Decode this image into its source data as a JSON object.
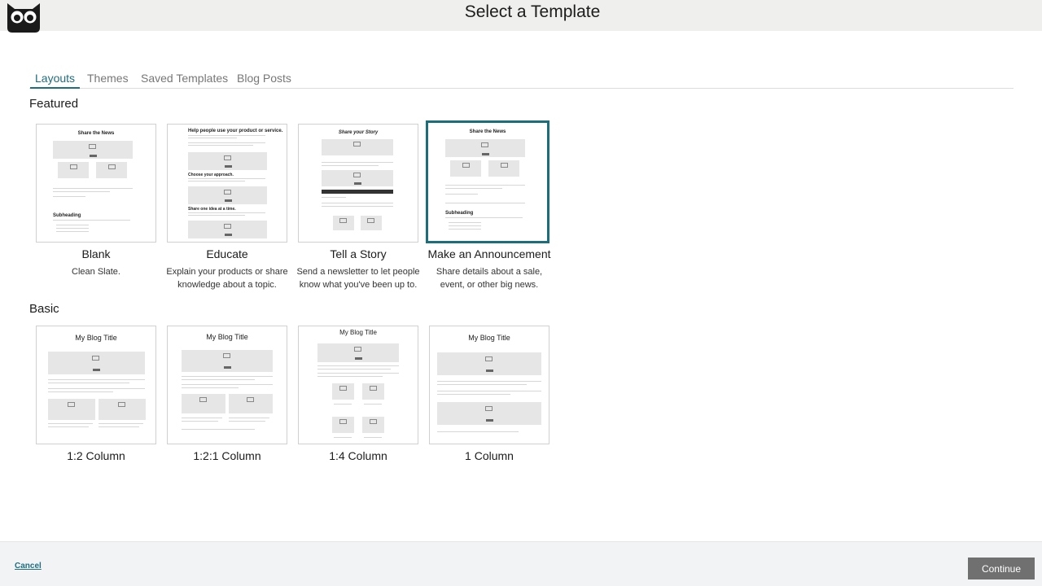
{
  "header": {
    "title": "Select a Template",
    "logo_icon": "owl-logo-icon"
  },
  "tabs": [
    {
      "label": "Layouts",
      "active": true
    },
    {
      "label": "Themes",
      "active": false
    },
    {
      "label": "Saved Templates",
      "active": false
    },
    {
      "label": "Blog Posts",
      "active": false
    }
  ],
  "featured": {
    "title": "Featured",
    "items": [
      {
        "name": "Blank",
        "desc1": "Clean Slate.",
        "desc2": "",
        "thumb_title": "Share the News"
      },
      {
        "name": "Educate",
        "desc1": "Explain your products or share",
        "desc2": "knowledge about a topic.",
        "thumb_title": "Help people use your product or service."
      },
      {
        "name": "Tell a Story",
        "desc1": "Send a newsletter to let people",
        "desc2": "know what you've been up to.",
        "thumb_title": "Share your Story"
      },
      {
        "name": "Make an Announcement",
        "desc1": "Share details about a sale,",
        "desc2": "event, or other big news.",
        "thumb_title": "Share the News",
        "selected": true
      }
    ]
  },
  "basic": {
    "title": "Basic",
    "items": [
      {
        "name": "1:2 Column",
        "thumb_title": "My Blog Title"
      },
      {
        "name": "1:2:1 Column",
        "thumb_title": "My Blog Title"
      },
      {
        "name": "1:4 Column",
        "thumb_title": "My Blog Title"
      },
      {
        "name": "1 Column",
        "thumb_title": "My Blog Title"
      }
    ]
  },
  "footer": {
    "cancel_label": "Cancel",
    "continue_label": "Continue"
  },
  "colors": {
    "accent": "#1f6d80",
    "selected_border": "#1b6e7c",
    "continue_bg": "#707070"
  }
}
